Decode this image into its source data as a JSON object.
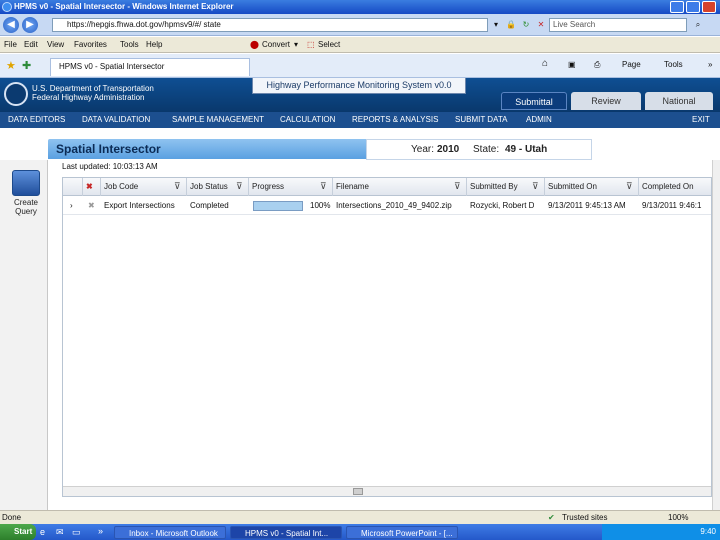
{
  "window": {
    "title": "HPMS v0 - Spatial Intersector - Windows Internet Explorer"
  },
  "browser": {
    "url": "https://hepgis.fhwa.dot.gov/hpmsv9/#/ state",
    "search_placeholder": "Live Search",
    "menu": [
      "File",
      "Edit",
      "View",
      "Favorites",
      "Tools",
      "Help"
    ],
    "convert_label": "Convert",
    "select_label": "Select",
    "tab_label": "HPMS v0 - Spatial Intersector",
    "page_label": "Page",
    "tools_label": "Tools"
  },
  "app_header": {
    "dept_line1": "U.S. Department of Transportation",
    "dept_line2": "Federal Highway Administration",
    "system_title": "Highway Performance Monitoring System v0.0",
    "tabs": [
      "Submittal",
      "Review",
      "National"
    ]
  },
  "nav": [
    "DATA EDITORS",
    "DATA VALIDATION",
    "SAMPLE MANAGEMENT",
    "CALCULATION",
    "REPORTS & ANALYSIS",
    "SUBMIT DATA",
    "ADMIN",
    "EXIT"
  ],
  "sidebar": {
    "create_query": "Create Query"
  },
  "panel": {
    "title": "Spatial Intersector",
    "year_label": "Year:",
    "year_value": "2010",
    "state_label": "State:",
    "state_value": "49 - Utah",
    "last_updated": "Last updated: 10:03:13 AM"
  },
  "grid": {
    "columns": [
      "Job Code",
      "Job Status",
      "Progress",
      "Filename",
      "Submitted By",
      "Submitted On",
      "Completed On"
    ],
    "rows": [
      {
        "job_code": "Export Intersections",
        "job_status": "Completed",
        "progress": 1.0,
        "progress_text": "100%",
        "filename": "Intersections_2010_49_9402.zip",
        "submitted_by": "Rozycki, Robert D",
        "submitted_on": "9/13/2011 9:45:13 AM",
        "completed_on": "9/13/2011 9:46:1"
      }
    ]
  },
  "status_bar": {
    "left": "Done",
    "zone": "Trusted sites",
    "zoom": "100%"
  },
  "taskbar": {
    "start": "Start",
    "items": [
      "Inbox - Microsoft Outlook",
      "HPMS v0 - Spatial Int...",
      "Microsoft PowerPoint - [..."
    ],
    "clock": "9:40"
  }
}
